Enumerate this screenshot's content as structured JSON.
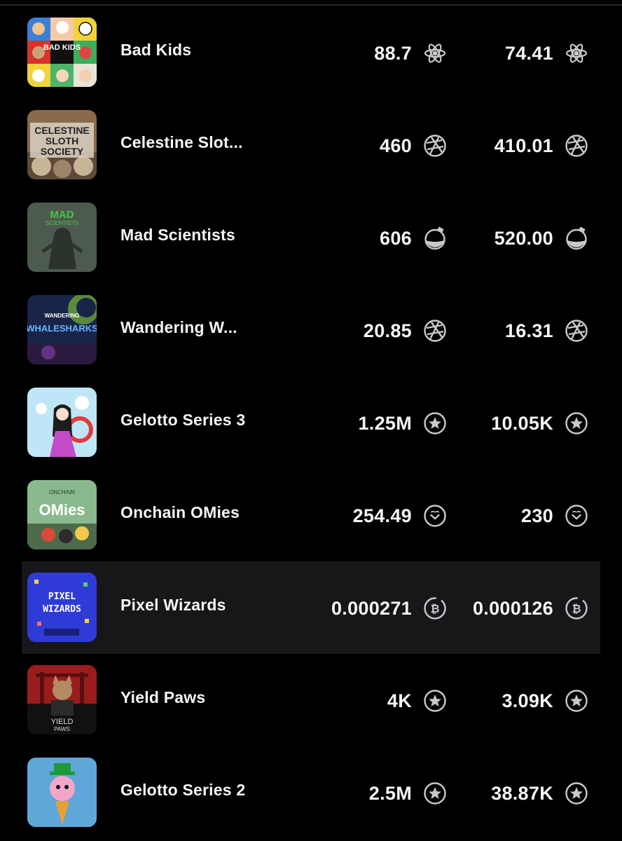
{
  "rows": [
    {
      "name": "Bad Kids",
      "floor": "88.7",
      "volume": "74.41",
      "token_icon": "atom-icon",
      "highlighted": false
    },
    {
      "name": "Celestine Slot...",
      "floor": "460",
      "volume": "410.01",
      "token_icon": "stargaze-orb-icon",
      "highlighted": false
    },
    {
      "name": "Mad Scientists",
      "floor": "606",
      "volume": "520.00",
      "token_icon": "potion-icon",
      "highlighted": false
    },
    {
      "name": "Wandering W...",
      "floor": "20.85",
      "volume": "16.31",
      "token_icon": "stargaze-orb-icon",
      "highlighted": false
    },
    {
      "name": "Gelotto Series 3",
      "floor": "1.25M",
      "volume": "10.05K",
      "token_icon": "star-circle-icon",
      "highlighted": false
    },
    {
      "name": "Onchain OMies",
      "floor": "254.49",
      "volume": "230",
      "token_icon": "smile-circle-icon",
      "highlighted": false
    },
    {
      "name": "Pixel Wizards",
      "floor": "0.000271",
      "volume": "0.000126",
      "token_icon": "bitcoin-circle-icon",
      "highlighted": true
    },
    {
      "name": "Yield Paws",
      "floor": "4K",
      "volume": "3.09K",
      "token_icon": "star-circle-icon",
      "highlighted": false
    },
    {
      "name": "Gelotto Series 2",
      "floor": "2.5M",
      "volume": "38.87K",
      "token_icon": "star-circle-icon",
      "highlighted": false
    }
  ],
  "thumb_text": {
    "bad_kids": "BAD KIDS",
    "celestine": [
      "CELESTINE",
      "SLOTH",
      "SOCIETY"
    ],
    "mad": [
      "MAD",
      "SCIENTISTS"
    ],
    "wandering": [
      "WANDERING",
      "WHALESHARKS"
    ],
    "omies": [
      "ONCHAIN",
      "OMies"
    ],
    "pixel": [
      "PIXEL",
      "WIZARDS"
    ],
    "yield": [
      "YIELD",
      "PAWS"
    ]
  },
  "colors": {
    "background": "#000000",
    "highlight_row": "#17171a",
    "text": "#f5f5f7",
    "icon": "#c9c9cd"
  }
}
